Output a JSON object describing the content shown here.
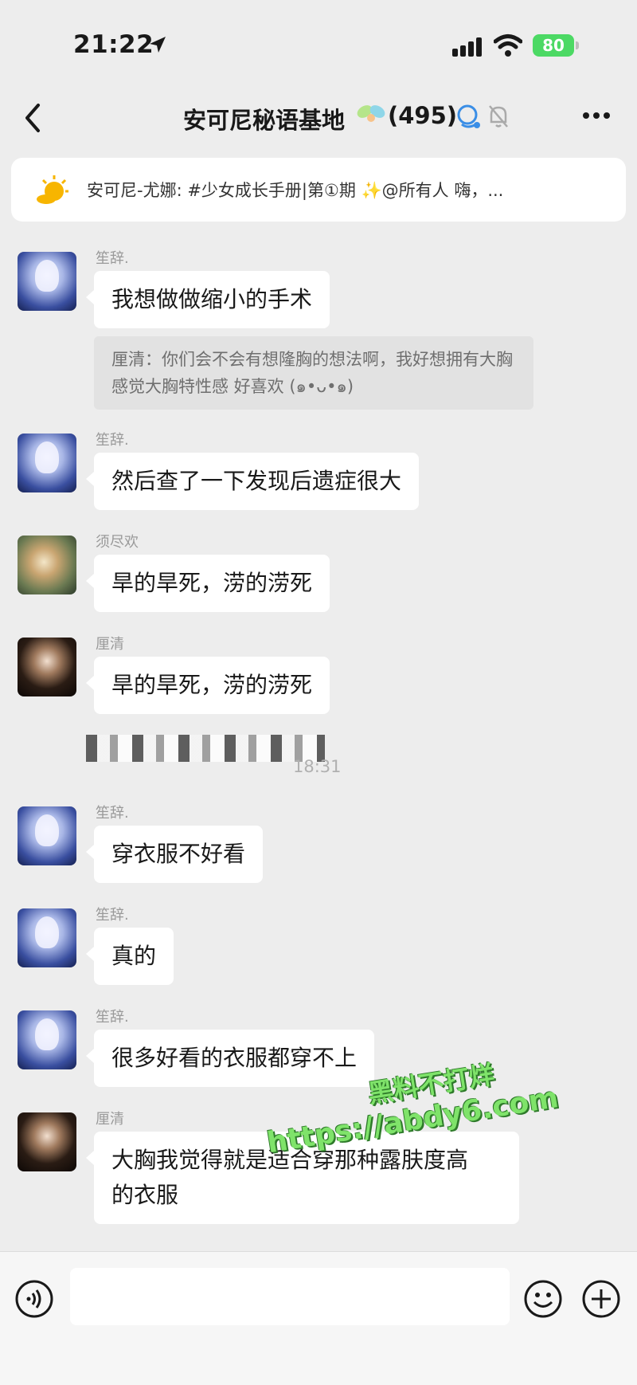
{
  "status_bar": {
    "time": "21:22",
    "battery": "80"
  },
  "header": {
    "title": "安可尼秘语基地",
    "member_count": "(495)"
  },
  "notice": {
    "text": "安可尼-尤娜: #少女成长手册|第①期 ",
    "sparkle": "✨",
    "text_after": "@所有人  嗨，..."
  },
  "messages": [
    {
      "sender": "笙辞.",
      "text": "我想做做缩小的手术"
    },
    {
      "quote": "厘清：你们会不会有想隆胸的想法啊，我好想拥有大胸 感觉大胸特性感 好喜欢 (๑•ᴗ•๑)"
    },
    {
      "sender": "笙辞.",
      "text": "然后查了一下发现后遗症很大"
    },
    {
      "sender": "须尽欢",
      "text": "旱的旱死，涝的涝死"
    },
    {
      "sender": "厘清",
      "text": "旱的旱死，涝的涝死"
    },
    {
      "time": "18:31"
    },
    {
      "sender": "笙辞.",
      "text": "穿衣服不好看"
    },
    {
      "sender": "笙辞.",
      "text": "真的"
    },
    {
      "sender": "笙辞.",
      "text": "很多好看的衣服都穿不上"
    },
    {
      "sender": "厘清",
      "text_line1": "大胸我觉得就是适合穿那种露肤度高",
      "text_line2": "的衣服"
    }
  ],
  "watermark": {
    "line1": "黑料不打烊",
    "line2": "https://abdy6.com"
  },
  "colors": {
    "background": "#ededed",
    "bubble": "#ffffff",
    "battery": "#4cd964"
  },
  "icons": [
    "location-arrow-icon",
    "signal-icon",
    "wifi-icon",
    "back-icon",
    "fairy-icon",
    "group-icon",
    "mute-bell-icon",
    "more-icon",
    "sun-icon",
    "voice-icon",
    "emoji-icon",
    "plus-icon"
  ]
}
